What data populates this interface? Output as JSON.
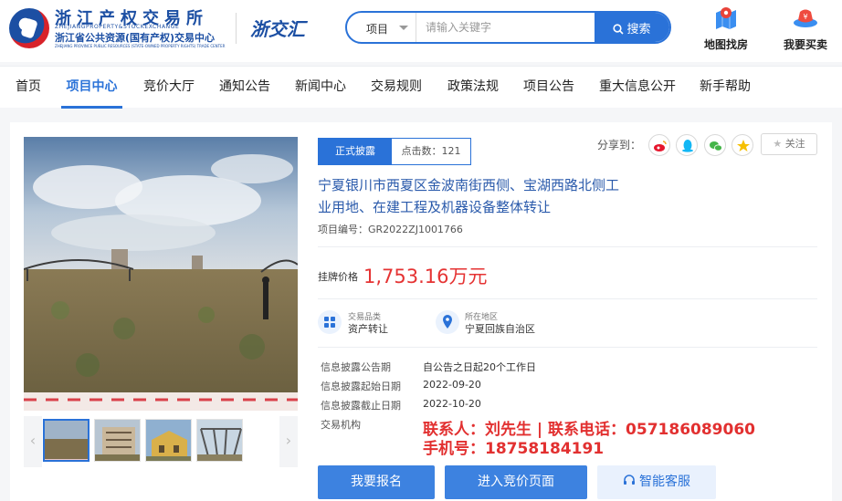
{
  "header": {
    "logo_title": "浙江产权交易所",
    "logo_en": "ZHEJIANGPROPERTY&STOCKEXCHANGE",
    "logo_sub": "浙江省公共资源(国有产权)交易中心",
    "logo_sub_en": "ZHEJIANG PROVINCE PUBLIC RESOURCES (STATE-OWNED PROPERTY RIGHTS) TRADE CENTER",
    "brand2": "浙交汇",
    "search": {
      "category": "项目",
      "placeholder": "请输入关键字",
      "button": "搜索"
    },
    "links": [
      {
        "label": "地图找房",
        "icon": "map-house-icon"
      },
      {
        "label": "我要买卖",
        "icon": "money-bag-icon"
      }
    ]
  },
  "nav": {
    "items": [
      {
        "label": "首页"
      },
      {
        "label": "项目中心"
      },
      {
        "label": "竞价大厅"
      },
      {
        "label": "通知公告"
      },
      {
        "label": "新闻中心"
      },
      {
        "label": "交易规则"
      },
      {
        "label": "政策法规"
      },
      {
        "label": "项目公告"
      },
      {
        "label": "重大信息公开"
      },
      {
        "label": "新手帮助"
      }
    ],
    "active": "项目中心"
  },
  "project": {
    "status": "正式披露",
    "clicks_label": "点击数：",
    "clicks": "121",
    "share_label": "分享到：",
    "share_icons": [
      "weibo-icon",
      "qq-icon",
      "wechat-icon",
      "qzone-icon"
    ],
    "follow": "关注",
    "title": "宁夏银川市西夏区金波南街西侧、宝湖西路北侧工业用地、在建工程及机器设备整体转让",
    "no_label": "项目编号：",
    "no": "GR2022ZJ1001766",
    "price_label": "挂牌价格",
    "price": "1,753.16万元",
    "category_label": "交易品类",
    "category": "资产转让",
    "region_label": "所在地区",
    "region": "宁夏回族自治区",
    "period_label": "信息披露公告期",
    "period": "自公告之日起20个工作日",
    "start_label": "信息披露起始日期",
    "start": "2022-09-20",
    "end_label": "信息披露截止日期",
    "end": "2022-10-20",
    "agency_label": "交易机构",
    "contact_line1": "联系人：刘先生 | 联系电话：057186089060",
    "contact_line2": "手机号：18758184191",
    "buttons": {
      "signup": "我要报名",
      "bid": "进入竞价页面",
      "service": "智能客服"
    }
  },
  "colors": {
    "brand_blue": "#2a72d8",
    "price_red": "#e53333",
    "contact_red": "#e23030"
  }
}
